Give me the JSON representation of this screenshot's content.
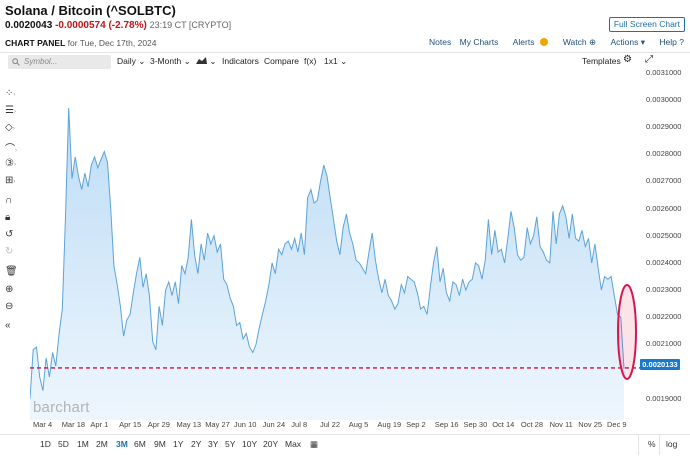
{
  "header": {
    "title": "Solana / Bitcoin (^SOLBTC)",
    "last": "0.0020043",
    "change": "-0.0000574 (-2.78%)",
    "meta": "23:19 CT [CRYPTO]",
    "full_screen_label": "Full Screen Chart",
    "panel_label": "CHART PANEL",
    "panel_date": "for Tue, Dec 17th, 2024",
    "links": {
      "notes": "Notes",
      "my_charts": "My Charts",
      "alerts": "Alerts",
      "watch": "Watch",
      "actions": "Actions",
      "help": "Help"
    }
  },
  "toolbar": {
    "symbol_placeholder": "Symbol...",
    "interval": "Daily",
    "range": "3-Month",
    "indicators": "Indicators",
    "compare": "Compare",
    "fx": "f(x)",
    "layout": "1x1",
    "templates": "Templates"
  },
  "left_tools": [
    "crosshair-icon",
    "lines-icon",
    "shapes-icon",
    "arc-icon",
    "fib-icon",
    "measure-icon",
    "magnet-icon",
    "lock-icon",
    "undo-icon",
    "redo-icon",
    "trash-icon",
    "zoom-in-icon",
    "zoom-out-icon",
    "collapse-icon"
  ],
  "yaxis": {
    "ticks": [
      "0.0031000",
      "0.0030000",
      "0.0029000",
      "0.0028000",
      "0.0027000",
      "0.0026000",
      "0.0025000",
      "0.0024000",
      "0.0023000",
      "0.0022000",
      "0.0021000",
      "0.0019000"
    ],
    "last_label": "0.0020133"
  },
  "xaxis": {
    "ticks": [
      "Mar 4",
      "Mar 18",
      "Apr 1",
      "Apr 15",
      "Apr 29",
      "May 13",
      "May 27",
      "Jun 10",
      "Jun 24",
      "Jul 8",
      "Jul 22",
      "Aug 5",
      "Aug 19",
      "Sep 2",
      "Sep 16",
      "Sep 30",
      "Oct 14",
      "Oct 28",
      "Nov 11",
      "Nov 25",
      "Dec 9"
    ]
  },
  "periods": [
    "1D",
    "5D",
    "1M",
    "2M",
    "3M",
    "6M",
    "9M",
    "1Y",
    "2Y",
    "3Y",
    "5Y",
    "10Y",
    "20Y",
    "Max"
  ],
  "active_period": "3M",
  "bottom_right": {
    "percent": "%",
    "log": "log"
  },
  "brand": "barchart",
  "colors": {
    "line": "#5ba3d9",
    "fill_top": "#bcdcf5",
    "fill_bottom": "#eef6fd",
    "last_line": "#c8143c",
    "ellipse": "#d6174e",
    "last_bg": "#1878cc"
  },
  "chart_data": {
    "type": "area",
    "ylim": [
      0.00184,
      0.00311
    ],
    "series": [
      {
        "values": [
          0.0019,
          0.00208,
          0.00209,
          0.00198,
          0.00193,
          0.00205,
          0.00198,
          0.00207,
          0.00202,
          0.00214,
          0.00223,
          0.00257,
          0.00297,
          0.00271,
          0.00279,
          0.00272,
          0.00267,
          0.00273,
          0.00268,
          0.00276,
          0.00279,
          0.00275,
          0.00278,
          0.00281,
          0.00277,
          0.0026,
          0.00239,
          0.00232,
          0.00224,
          0.00213,
          0.00219,
          0.00221,
          0.00229,
          0.00236,
          0.00242,
          0.00231,
          0.00236,
          0.00228,
          0.00211,
          0.00208,
          0.00224,
          0.00217,
          0.0023,
          0.00233,
          0.00228,
          0.00233,
          0.00225,
          0.00239,
          0.00236,
          0.00242,
          0.00256,
          0.00243,
          0.00236,
          0.00247,
          0.00241,
          0.00251,
          0.00247,
          0.0025,
          0.00244,
          0.00247,
          0.00234,
          0.00232,
          0.00227,
          0.00224,
          0.00217,
          0.00218,
          0.00212,
          0.00214,
          0.00209,
          0.00207,
          0.0021,
          0.00216,
          0.00221,
          0.00226,
          0.00232,
          0.0024,
          0.00236,
          0.00245,
          0.00243,
          0.00247,
          0.00248,
          0.00245,
          0.00249,
          0.00244,
          0.00251,
          0.00243,
          0.00264,
          0.00267,
          0.00262,
          0.00263,
          0.0027,
          0.00276,
          0.00272,
          0.00264,
          0.00256,
          0.00248,
          0.00243,
          0.00253,
          0.00258,
          0.00251,
          0.00247,
          0.00241,
          0.0024,
          0.00238,
          0.00236,
          0.00244,
          0.00251,
          0.00241,
          0.00234,
          0.00229,
          0.00234,
          0.00228,
          0.00226,
          0.00223,
          0.00225,
          0.00232,
          0.00229,
          0.00235,
          0.00234,
          0.00233,
          0.00229,
          0.00223,
          0.00224,
          0.00221,
          0.00231,
          0.0024,
          0.00246,
          0.00233,
          0.00238,
          0.00229,
          0.00226,
          0.00233,
          0.00232,
          0.00228,
          0.00234,
          0.0023,
          0.00233,
          0.00234,
          0.0024,
          0.00239,
          0.00234,
          0.00241,
          0.00256,
          0.00243,
          0.00252,
          0.00244,
          0.00245,
          0.0024,
          0.00249,
          0.00259,
          0.00253,
          0.00243,
          0.00241,
          0.00242,
          0.00253,
          0.00247,
          0.0025,
          0.00257,
          0.00246,
          0.00244,
          0.00241,
          0.0024,
          0.00259,
          0.00247,
          0.00258,
          0.00261,
          0.00257,
          0.00249,
          0.00258,
          0.00249,
          0.00248,
          0.00252,
          0.00246,
          0.00249,
          0.0024,
          0.00247,
          0.00238,
          0.0023,
          0.00235,
          0.00234,
          0.00235,
          0.00228,
          0.00221,
          0.0022,
          0.00201
        ]
      }
    ]
  }
}
